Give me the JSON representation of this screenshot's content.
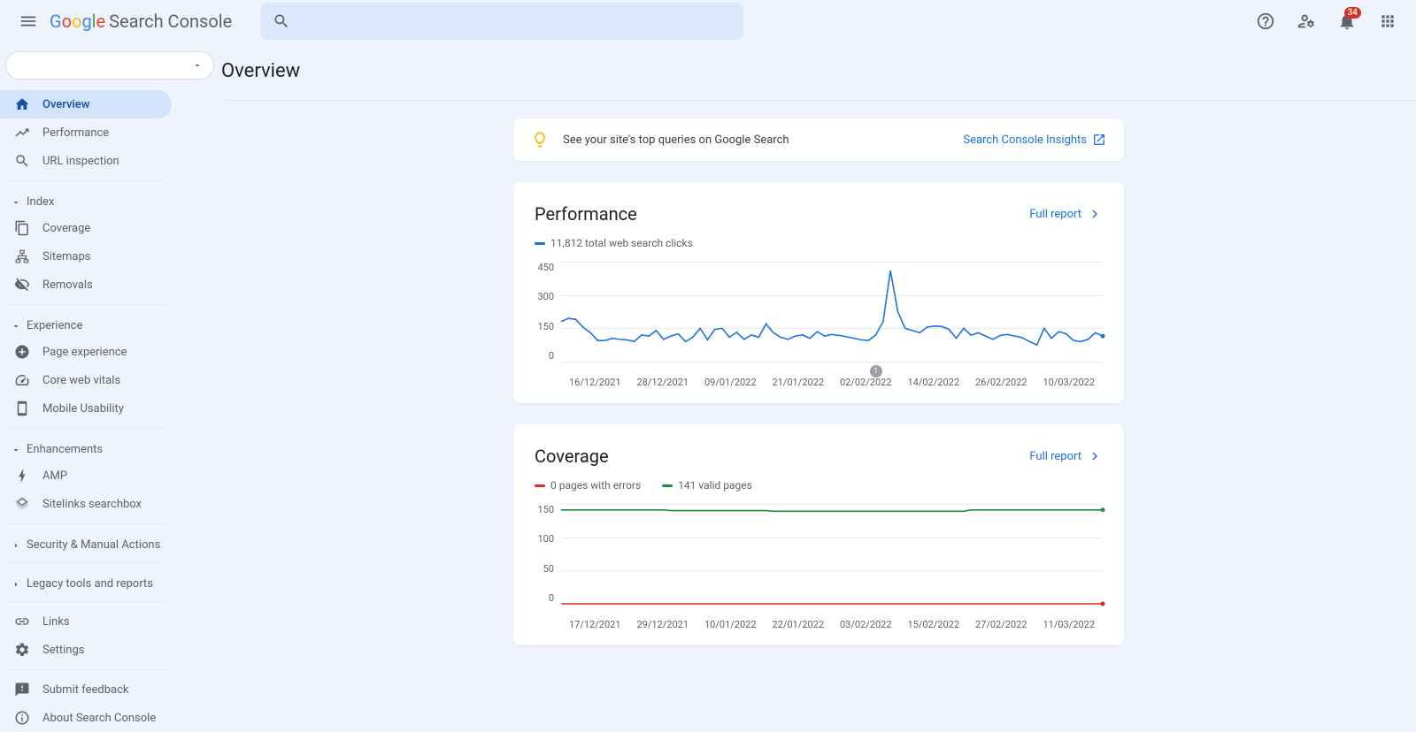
{
  "header": {
    "product": "Search Console",
    "search_placeholder": "",
    "notification_count": "34"
  },
  "sidebar": {
    "nav": {
      "overview": "Overview",
      "performance": "Performance",
      "url_inspection": "URL inspection"
    },
    "sections": {
      "index": "Index",
      "experience": "Experience",
      "enhancements": "Enhancements",
      "security": "Security & Manual Actions",
      "legacy": "Legacy tools and reports"
    },
    "items": {
      "coverage": "Coverage",
      "sitemaps": "Sitemaps",
      "removals": "Removals",
      "page_experience": "Page experience",
      "core_web_vitals": "Core web vitals",
      "mobile_usability": "Mobile Usability",
      "amp": "AMP",
      "sitelinks": "Sitelinks searchbox",
      "links": "Links",
      "settings": "Settings",
      "feedback": "Submit feedback",
      "about": "About Search Console"
    }
  },
  "page": {
    "title": "Overview",
    "insights_msg": "See your site's top queries on Google Search",
    "insights_link": "Search Console Insights",
    "full_report": "Full report"
  },
  "performance_card": {
    "title": "Performance",
    "legend": "11,812 total web search clicks",
    "event_marker": "1"
  },
  "coverage_card": {
    "title": "Coverage",
    "legend_errors": "0 pages with errors",
    "legend_valid": "141 valid pages"
  },
  "chart_data": [
    {
      "type": "line",
      "title": "Performance",
      "ylabel": "clicks",
      "ylim": [
        0,
        450
      ],
      "y_ticks": [
        0,
        150,
        300,
        450
      ],
      "categories": [
        "16/12/2021",
        "28/12/2021",
        "09/01/2022",
        "21/01/2022",
        "02/02/2022",
        "14/02/2022",
        "26/02/2022",
        "10/03/2022"
      ],
      "series": [
        {
          "name": "total web search clicks",
          "color": "#1a73e8",
          "values": [
            180,
            195,
            190,
            155,
            130,
            95,
            95,
            105,
            100,
            98,
            90,
            120,
            115,
            140,
            100,
            115,
            125,
            90,
            110,
            150,
            98,
            145,
            150,
            110,
            132,
            100,
            120,
            110,
            170,
            130,
            110,
            100,
            115,
            120,
            105,
            135,
            115,
            122,
            118,
            112,
            105,
            98,
            95,
            120,
            180,
            410,
            225,
            150,
            140,
            130,
            155,
            160,
            158,
            145,
            105,
            150,
            119,
            130,
            115,
            100,
            118,
            122,
            115,
            108,
            90,
            75,
            150,
            105,
            135,
            125,
            95,
            90,
            100,
            130,
            115
          ]
        }
      ],
      "event_marker_index": 43
    },
    {
      "type": "line",
      "title": "Coverage",
      "ylabel": "pages",
      "ylim": [
        0,
        150
      ],
      "y_ticks": [
        0,
        50,
        100,
        150
      ],
      "categories": [
        "17/12/2021",
        "29/12/2021",
        "10/01/2022",
        "22/01/2022",
        "03/02/2022",
        "15/02/2022",
        "27/02/2022",
        "11/03/2022"
      ],
      "series": [
        {
          "name": "pages with errors",
          "color": "#d93025",
          "values": [
            0,
            0,
            0,
            0,
            0,
            0,
            0,
            0,
            0,
            0,
            0,
            0,
            0,
            0,
            0,
            0,
            0,
            0,
            0,
            0,
            0,
            0,
            0,
            0,
            0,
            0,
            0,
            0,
            0,
            0,
            0,
            0,
            0,
            0,
            0,
            0,
            0,
            0,
            0,
            0,
            0,
            0,
            0,
            0,
            0,
            0,
            0,
            0,
            0,
            0,
            0,
            0,
            0,
            0,
            0,
            0,
            0,
            0,
            0,
            0,
            0,
            0,
            0,
            0,
            0,
            0,
            0,
            0,
            0,
            0,
            0,
            0,
            0,
            0,
            0
          ]
        },
        {
          "name": "valid pages",
          "color": "#1e8e3e",
          "values": [
            141,
            141,
            141,
            141,
            141,
            141,
            141,
            141,
            141,
            141,
            141,
            141,
            141,
            141,
            141,
            140,
            140,
            140,
            140,
            140,
            140,
            140,
            140,
            140,
            140,
            140,
            140,
            140,
            140,
            139,
            139,
            139,
            139,
            139,
            139,
            139,
            139,
            139,
            139,
            139,
            139,
            139,
            139,
            139,
            139,
            139,
            139,
            139,
            139,
            139,
            139,
            139,
            139,
            139,
            139,
            139,
            141,
            141,
            141,
            141,
            141,
            141,
            141,
            141,
            141,
            141,
            141,
            141,
            141,
            141,
            141,
            141,
            141,
            141,
            141
          ]
        }
      ]
    }
  ]
}
